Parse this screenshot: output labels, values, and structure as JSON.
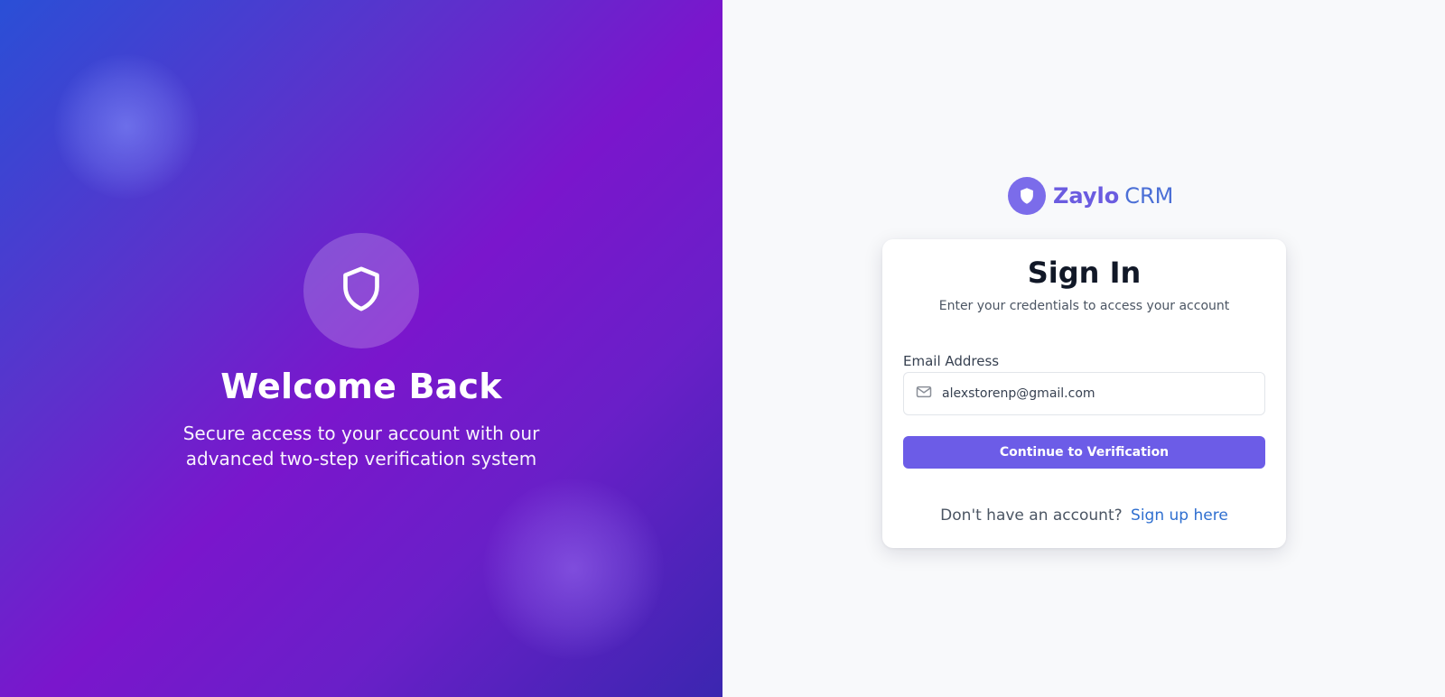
{
  "hero": {
    "icon": "shield-icon",
    "title": "Welcome Back",
    "subtitle": "Secure access to your account with our advanced two-step verification system"
  },
  "brand": {
    "icon": "shield-icon",
    "name": "Zaylo",
    "suffix": "CRM"
  },
  "signin": {
    "title": "Sign In",
    "subtitle": "Enter your credentials to access your account",
    "email_label": "Email Address",
    "email_value": "alexstorenp@gmail.com",
    "email_icon": "mail-icon",
    "submit_label": "Continue to Verification",
    "signup_prompt": "Don't have an account?",
    "signup_link": "Sign up here"
  },
  "colors": {
    "accent": "#6c5ce7",
    "link": "#2f6fd0",
    "gradient_start": "#2a4fd6",
    "gradient_mid": "#7a16cc",
    "gradient_end": "#3b26b0"
  }
}
